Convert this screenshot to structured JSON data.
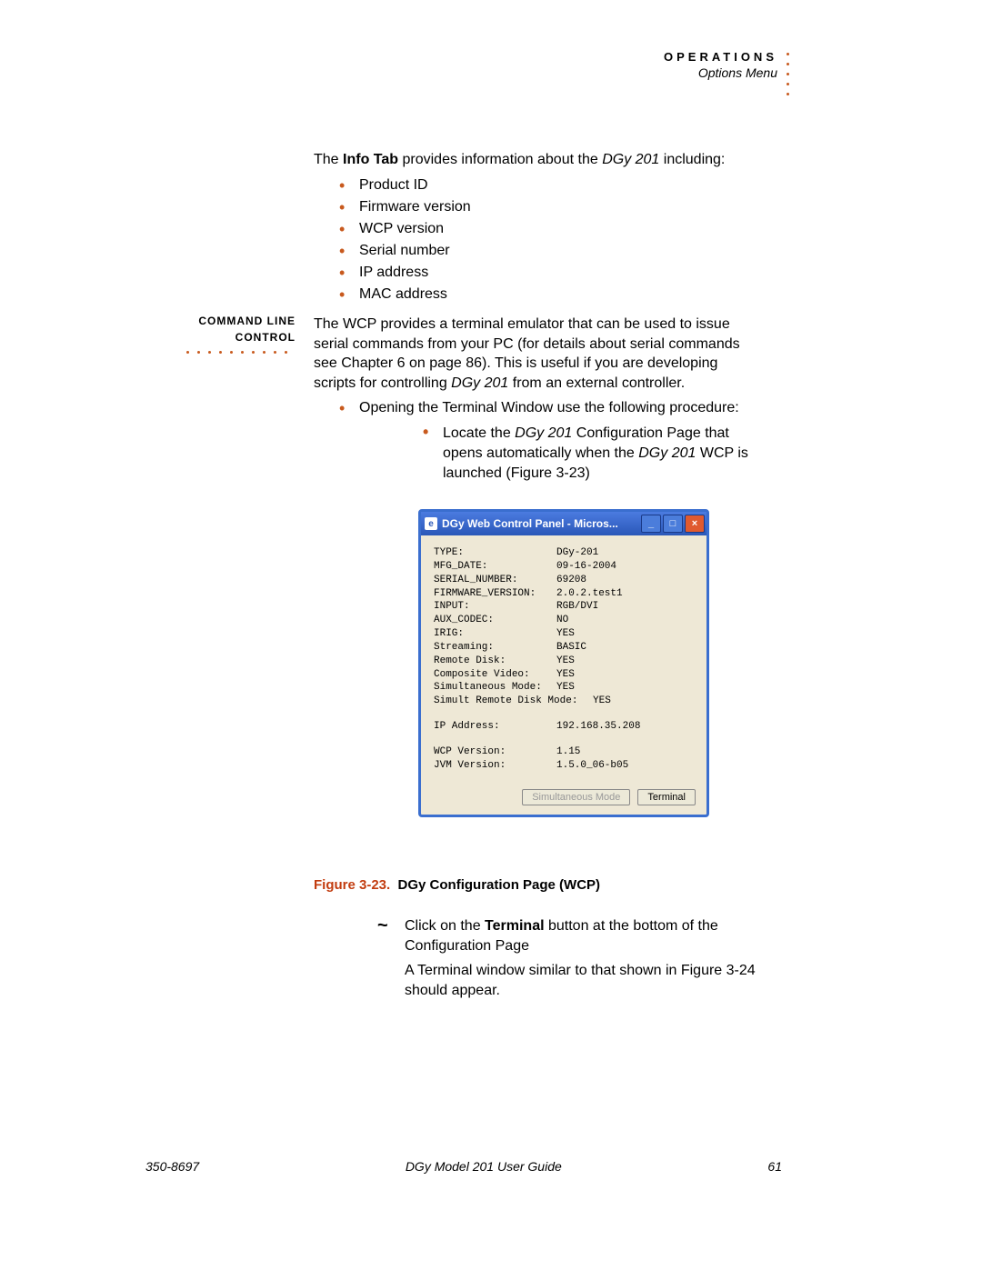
{
  "header": {
    "section": "OPERATIONS",
    "subsection": "Options Menu"
  },
  "intro": {
    "prefix": "The ",
    "bold1": "Info Tab",
    "mid": " provides information about the ",
    "italic1": "DGy 201",
    "suffix": " including:"
  },
  "info_list": {
    "i1": "Product ID",
    "i2": "Firmware version",
    "i3": "WCP version",
    "i4": "Serial number",
    "i5": "IP address",
    "i6": "MAC address"
  },
  "sidebar": {
    "l1": "COMMAND LINE",
    "l2": "CONTROL"
  },
  "sec2": {
    "p1a": "The WCP provides a terminal emulator that can be used to issue serial commands from your PC (for details about serial commands see Chapter 6 on page 86). This is useful if you are developing scripts for controlling ",
    "p1_italic": "DGy 201",
    "p1b": " from an external controller.",
    "bullet1": "Opening the Terminal Window use the following procedure:",
    "sub1a": "Locate the ",
    "sub1_i1": "DGy 201",
    "sub1b": " Configuration Page that opens automatically when the ",
    "sub1_i2": "DGy 201",
    "sub1c": " WCP is launched (Figure 3-23)"
  },
  "window": {
    "title": "DGy Web Control Panel - Micros...",
    "rows": [
      {
        "k": "TYPE:",
        "v": "DGy-201"
      },
      {
        "k": "MFG_DATE:",
        "v": "09-16-2004"
      },
      {
        "k": "SERIAL_NUMBER:",
        "v": "69208"
      },
      {
        "k": "FIRMWARE_VERSION:",
        "v": "2.0.2.test1"
      },
      {
        "k": "INPUT:",
        "v": "RGB/DVI"
      },
      {
        "k": "AUX_CODEC:",
        "v": "NO"
      },
      {
        "k": "IRIG:",
        "v": "YES"
      },
      {
        "k": "Streaming:",
        "v": "BASIC"
      },
      {
        "k": "Remote Disk:",
        "v": "YES"
      },
      {
        "k": "Composite Video:",
        "v": "YES"
      },
      {
        "k": "Simultaneous Mode:",
        "v": "YES"
      },
      {
        "k": "Simult Remote Disk Mode:",
        "v": "YES"
      }
    ],
    "ip": {
      "k": "IP Address:",
      "v": "192.168.35.208"
    },
    "wcp": {
      "k": "WCP Version:",
      "v": "1.15"
    },
    "jvm": {
      "k": "JVM Version:",
      "v": "1.5.0_06-b05"
    },
    "btn_sim": "Simultaneous Mode",
    "btn_term": "Terminal"
  },
  "figure": {
    "num": "Figure 3-23.",
    "title": "DGy Configuration Page (WCP)"
  },
  "after": {
    "sub2a": "Click on the ",
    "sub2_bold": "Terminal",
    "sub2b": " button at the bottom of the Configuration Page",
    "sub3": "A Terminal window similar to that shown in Figure 3-24 should appear."
  },
  "footer": {
    "left": "350-8697",
    "center": "DGy Model 201 User Guide",
    "right": "61"
  }
}
